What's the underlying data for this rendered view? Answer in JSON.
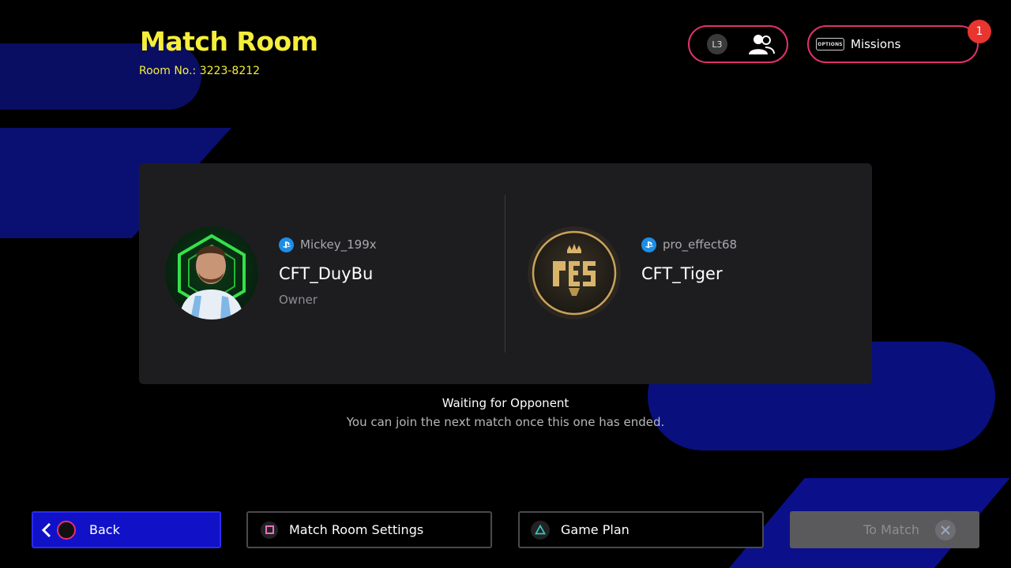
{
  "header": {
    "title": "Match Room",
    "room_label": "Room No.: 3223-8212"
  },
  "top_buttons": {
    "l3_key": "L3",
    "options_key": "OPTIONS",
    "missions_label": "Missions",
    "missions_badge": "1"
  },
  "players": [
    {
      "psn_id": "Mickey_199x",
      "gamer_name": "CFT_DuyBu",
      "role": "Owner"
    },
    {
      "psn_id": "pro_effect68",
      "gamer_name": "CFT_Tiger",
      "role": ""
    }
  ],
  "status": {
    "title": "Waiting for Opponent",
    "message": "You can join the next match once this one has ended."
  },
  "bottom_bar": {
    "back": "Back",
    "settings": "Match Room Settings",
    "game_plan": "Game Plan",
    "to_match": "To Match"
  },
  "colors": {
    "title_yellow": "#f5ee3b",
    "accent_pink": "#e0316e",
    "back_blue": "#1111c8",
    "badge_red": "#e8352f",
    "psn_blue": "#1c8ee8",
    "panel": "#1d1d20"
  }
}
